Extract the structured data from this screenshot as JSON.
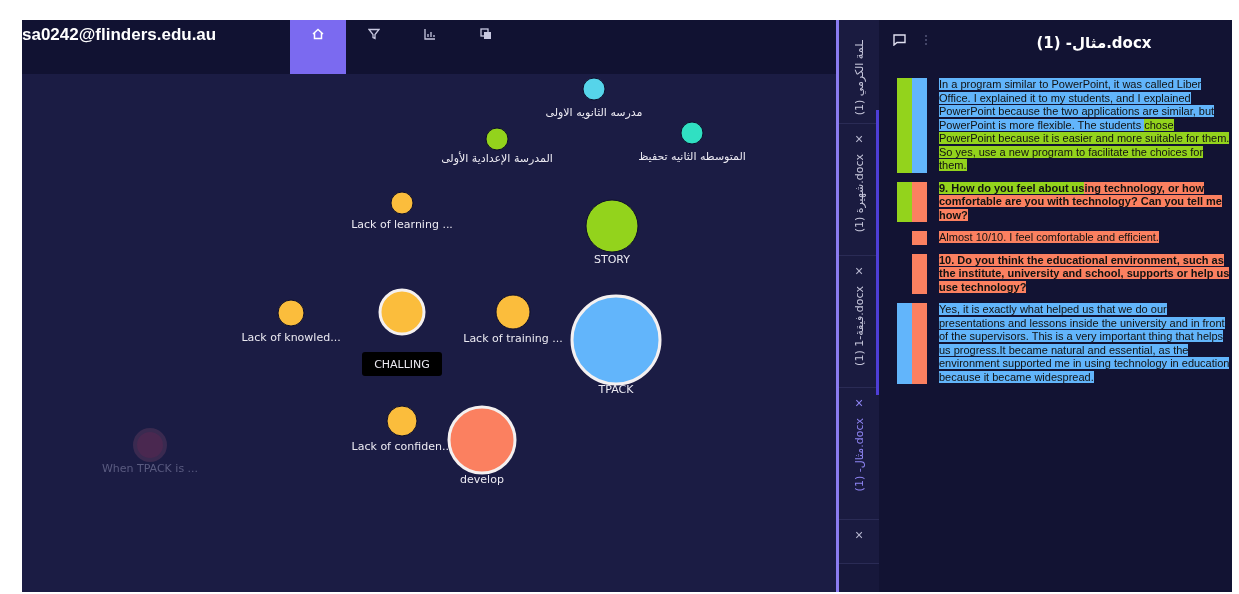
{
  "user": {
    "email": "sa0242@flinders.edu.au"
  },
  "toolbar_tabs": [
    {
      "kind": "home",
      "selected": true
    },
    {
      "kind": "filter",
      "selected": false
    },
    {
      "kind": "chart",
      "selected": false
    },
    {
      "kind": "copy",
      "selected": false
    }
  ],
  "graph": {
    "nodes": [
      {
        "label": "مدرسه الثانويه الاولى",
        "color": "#56d4ea",
        "selected": false,
        "outlined": false,
        "dimmed": false
      },
      {
        "label": "المدرسة الإعدادية الأولى",
        "color": "#93d31c",
        "selected": false,
        "outlined": false,
        "dimmed": false
      },
      {
        "label": "المتوسطه الثانيه تحفيظ",
        "color": "#30e0c2",
        "selected": false,
        "outlined": false,
        "dimmed": false
      },
      {
        "label": "Lack of learning ...",
        "color": "#fbbd3c",
        "selected": false,
        "outlined": false,
        "dimmed": false
      },
      {
        "label": "STORY",
        "color": "#93d31c",
        "selected": false,
        "outlined": false,
        "dimmed": false
      },
      {
        "label": "Lack of knowled...",
        "color": "#fbbd3c",
        "selected": false,
        "outlined": false,
        "dimmed": false
      },
      {
        "label": "CHALLING",
        "color": "#fbbd3c",
        "selected": true,
        "outlined": true,
        "dimmed": false
      },
      {
        "label": "Lack of training ...",
        "color": "#fbbd3c",
        "selected": false,
        "outlined": false,
        "dimmed": false
      },
      {
        "label": "TPACK",
        "color": "#62b5fb",
        "selected": false,
        "outlined": true,
        "dimmed": false
      },
      {
        "label": "Lack of confiden...",
        "color": "#fbbd3c",
        "selected": false,
        "outlined": false,
        "dimmed": false
      },
      {
        "label": "develop",
        "color": "#fb8060",
        "selected": false,
        "outlined": true,
        "dimmed": false
      },
      {
        "label": "When TPACK is ...",
        "color": "#4a2850",
        "selected": false,
        "outlined": false,
        "dimmed": true
      }
    ]
  },
  "document_tabs": [
    {
      "label": "(1) ـلمة الكرمي",
      "selected": false
    },
    {
      "label": "(1) شهيرة.docx",
      "close": "×",
      "selected": false
    },
    {
      "label": "(1) 1-فيقة.docx",
      "close": "×",
      "selected": false
    },
    {
      "label": "(1) -مثال.docx",
      "close": "×",
      "selected": true
    },
    {
      "close": "×",
      "selected": false
    }
  ],
  "document": {
    "title": "(1) -مثال.docx",
    "paragraphs": [
      {
        "bold": false,
        "codes": [
          {
            "color": "#93d31c"
          },
          {
            "color": "#62b5fb"
          }
        ],
        "segments": [
          {
            "text": "In a program similar to PowerPoint, it was called Liber Office. I explained it to my students, and I explained PowerPoint because the two applications are similar, but PowerPoint is more flexible. The students ",
            "color": "#62b5fb"
          },
          {
            "text": "chose PowerPoint because it is easier and more suitable for them. So yes, use a new program to facilitate the choices for them.",
            "color": "#93d31c"
          }
        ]
      },
      {
        "bold": true,
        "codes": [
          {
            "color": "#93d31c"
          },
          {
            "color": "#fb8060"
          }
        ],
        "segments": [
          {
            "text": "9. How do you feel about us",
            "color": "#93d31c"
          },
          {
            "text": "ing technology, or how comfortable are you with technology? Can you tell me how?",
            "color": "#fb8060"
          }
        ]
      },
      {
        "bold": false,
        "codes": [
          {
            "color": "#fb8060"
          }
        ],
        "segments": [
          {
            "text": "Almost 10/10. I feel comfortable and efficient.",
            "color": "#fb8060"
          }
        ]
      },
      {
        "bold": true,
        "codes": [
          {
            "color": "#fb8060"
          }
        ],
        "segments": [
          {
            "text": "10. Do you think the educational environment, such as the institute, university and school, supports or help us use technology?",
            "color": "#fb8060"
          }
        ]
      },
      {
        "bold": false,
        "codes": [
          {
            "color": "#62b5fb"
          },
          {
            "color": "#fb8060"
          }
        ],
        "segments": [
          {
            "text": "Yes, it is exactly what helped us that we do our presentations and lessons inside the university and in front of the supervisors. This is a very important thing that helps us progress.It became natural and essential, as the environment supported me in using technology in education because it became widespread.",
            "color": "#62b5fb"
          }
        ]
      }
    ]
  }
}
